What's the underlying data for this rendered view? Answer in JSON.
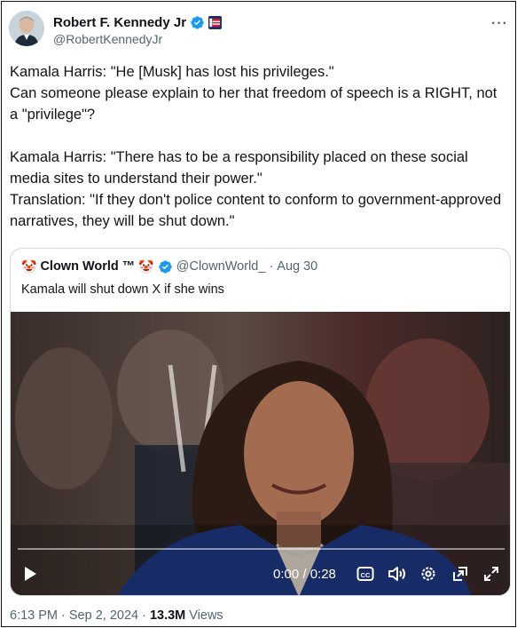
{
  "post": {
    "author_name": "Robert F. Kennedy Jr",
    "author_handle": "@RobertKennedyJr",
    "more_menu": "···",
    "paragraphs": [
      "Kamala Harris: \"He [Musk] has lost his privileges.\"",
      "Can someone please explain to her that freedom of speech is a RIGHT, not a \"privilege\"?",
      "",
      "Kamala Harris: \"There has to be a responsibility placed on these social media sites to understand their power.\"",
      "Translation: \"If they don't police content to conform to government-approved narratives, they will be shut down.\""
    ],
    "timestamp": "6:13 PM · Sep 2, 2024 ·",
    "views_count": "13.3M",
    "views_label": "Views"
  },
  "quote": {
    "prefix_emoji": "🤡",
    "author_name": "Clown World ™",
    "suffix_emoji": "🤡",
    "author_handle": "@ClownWorld_",
    "separator": "·",
    "date": "Aug 30",
    "text": "Kamala will shut down X if she wins"
  },
  "video": {
    "timecode": "0:00 / 0:28",
    "progress_fraction": 0.0,
    "icons": [
      "play-icon",
      "captions-icon",
      "volume-icon",
      "settings-icon",
      "pip-icon",
      "fullscreen-icon"
    ]
  },
  "colors": {
    "verified_blue": "#1d9bf0",
    "text_primary": "#0f1419",
    "text_secondary": "#536471",
    "border": "#cfd9de"
  }
}
